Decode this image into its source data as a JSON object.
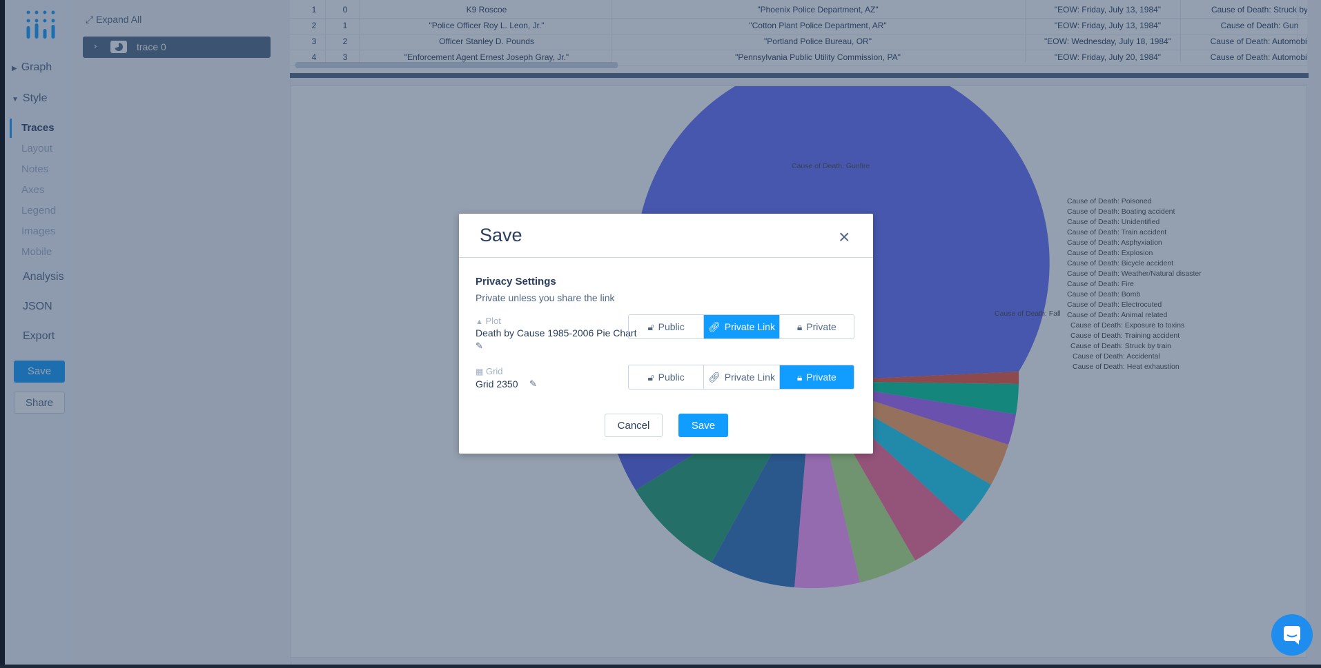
{
  "sidebar": {
    "sections": [
      {
        "label": "Graph",
        "expanded": false
      },
      {
        "label": "Style",
        "expanded": true
      }
    ],
    "style_items": [
      "Traces",
      "Layout",
      "Notes",
      "Axes",
      "Legend",
      "Images",
      "Mobile"
    ],
    "active_item": "Traces",
    "other_items": [
      "Analysis",
      "JSON",
      "Export"
    ],
    "save_label": "Save",
    "share_label": "Share"
  },
  "trace_panel": {
    "expand_all": "Expand All",
    "trace_name": "trace 0"
  },
  "grid": {
    "rows": [
      [
        "1",
        "0",
        "K9 Roscoe",
        "\"Phoenix Police Department, AZ\"",
        "\"EOW: Friday, July 13, 1984\"",
        "Cause of Death: Struck by"
      ],
      [
        "2",
        "1",
        "\"Police Officer Roy L. Leon, Jr.\"",
        "\"Cotton Plant Police Department, AR\"",
        "\"EOW: Friday, July 13, 1984\"",
        "Cause of Death: Gun"
      ],
      [
        "3",
        "2",
        "Officer Stanley D. Pounds",
        "\"Portland Police Bureau, OR\"",
        "\"EOW: Wednesday, July 18, 1984\"",
        "Cause of Death: Automobil"
      ],
      [
        "4",
        "3",
        "\"Enforcement Agent Ernest Joseph Gray, Jr.\"",
        "\"Pennsylvania Public Utility Commission, PA\"",
        "\"EOW: Friday, July 20, 1984\"",
        "Cause of Death: Automobil"
      ]
    ]
  },
  "plot": {
    "legend_labels": [
      "Cause of Death: Poisoned",
      "Cause of Death: Boating accident",
      "Cause of Death: Unidentified",
      "Cause of Death: Train accident",
      "Cause of Death: Asphyxiation",
      "Cause of Death: Explosion",
      "Cause of Death: Bicycle accident",
      "Cause of Death: Weather/Natural disaster",
      "Cause of Death: Fire",
      "Cause of Death: Bomb",
      "Cause of Death: Electrocuted",
      "Cause of Death: Animal related",
      "Cause of Death: Exposure to toxins",
      "Cause of Death: Training accident",
      "Cause of Death: Struck by train",
      "Cause of Death: Accidental",
      "Cause of Death: Heat exhaustion"
    ],
    "slice_labels": {
      "gunfire": "Cause of Death: Gunfire",
      "fall": "Cause of Death: Fall"
    },
    "colors": [
      "#636efa",
      "#ef553b",
      "#00cc96",
      "#ab63fa",
      "#ffa15a",
      "#19d3f3",
      "#ff6692",
      "#b6e880"
    ]
  },
  "dialog": {
    "title": "Save",
    "privacy_heading": "Privacy Settings",
    "privacy_sub": "Private unless you share the link",
    "plot": {
      "type_label": "Plot",
      "name": "Death by Cause 1985-2006 Pie Chart",
      "selected": "Private Link"
    },
    "grid": {
      "type_label": "Grid",
      "name": "Grid 2350",
      "selected": "Private"
    },
    "options": [
      "Public",
      "Private Link",
      "Private"
    ],
    "cancel_label": "Cancel",
    "save_label": "Save"
  }
}
